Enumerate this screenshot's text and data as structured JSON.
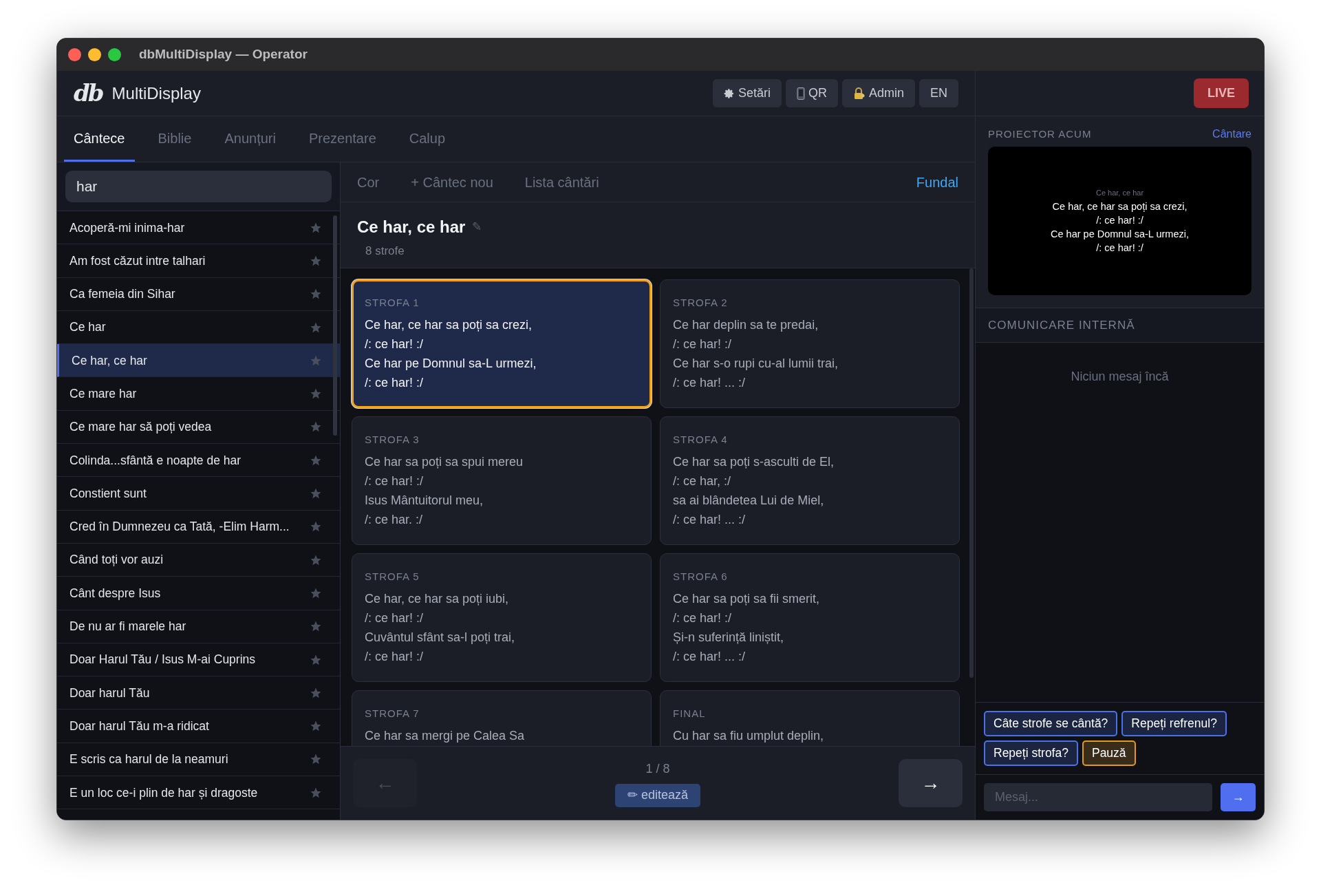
{
  "window": {
    "title": "dbMultiDisplay — Operator"
  },
  "header": {
    "logo": "db",
    "app_name": "MultiDisplay",
    "buttons": [
      {
        "label": "Setări",
        "kind": "gear"
      },
      {
        "label": "QR",
        "kind": "phone"
      },
      {
        "label": "Admin",
        "kind": "lock"
      },
      {
        "label": "EN",
        "kind": "plain"
      }
    ]
  },
  "live_button": {
    "label": "LIVE"
  },
  "tabs": [
    {
      "label": "Cântece",
      "selected": true
    },
    {
      "label": "Biblie",
      "selected": false
    },
    {
      "label": "Anunțuri",
      "selected": false
    },
    {
      "label": "Prezentare",
      "selected": false
    },
    {
      "label": "Calup",
      "selected": false
    }
  ],
  "search": {
    "value": "har"
  },
  "songs": [
    {
      "title": "Acoperă-mi inima-har",
      "selected": false
    },
    {
      "title": "Am fost căzut intre talhari",
      "selected": false
    },
    {
      "title": "Ca femeia din Sihar",
      "selected": false
    },
    {
      "title": "Ce har",
      "selected": false
    },
    {
      "title": "Ce har, ce har",
      "selected": true
    },
    {
      "title": "Ce mare har",
      "selected": false
    },
    {
      "title": "Ce mare har să poți vedea",
      "selected": false
    },
    {
      "title": "Colinda...sfântă e noapte de har",
      "selected": false
    },
    {
      "title": "Constient sunt",
      "selected": false
    },
    {
      "title": "Cred în Dumnezeu ca Tată, -Elim Harm...",
      "selected": false
    },
    {
      "title": "Când toți vor auzi",
      "selected": false
    },
    {
      "title": "Cânt despre Isus",
      "selected": false
    },
    {
      "title": "De nu ar fi marele har",
      "selected": false
    },
    {
      "title": "Doar Harul Tău / Isus M-ai Cuprins",
      "selected": false
    },
    {
      "title": "Doar harul Tău",
      "selected": false
    },
    {
      "title": "Doar harul Tău m-a ridicat",
      "selected": false
    },
    {
      "title": "E scris ca harul de la neamuri",
      "selected": false
    },
    {
      "title": "E un loc ce-i plin de har și dragoste",
      "selected": false
    }
  ],
  "toolbar": {
    "items": [
      "Cor",
      "+ Cântec nou",
      "Lista cântări"
    ],
    "background_link": "Fundal"
  },
  "song": {
    "title": "Ce har, ce har",
    "edit_icon": "✎",
    "count": "8 strofe"
  },
  "verses": [
    {
      "label": "STROFA 1",
      "lines": [
        "Ce har, ce har sa poți sa crezi,",
        "/: ce har! :/",
        "Ce har pe Domnul sa-L urmezi,",
        "/: ce har! :/"
      ],
      "selected": true
    },
    {
      "label": "STROFA 2",
      "lines": [
        "Ce har deplin sa te predai,",
        "/: ce har! :/",
        "Ce har s-o rupi cu-al lumii trai,",
        "/: ce har! ... :/"
      ],
      "selected": false
    },
    {
      "label": "STROFA 3",
      "lines": [
        "Ce har sa poți sa spui mereu",
        "/: ce har! :/",
        "Isus Mântuitorul meu,",
        "/: ce har. :/"
      ],
      "selected": false
    },
    {
      "label": "STROFA 4",
      "lines": [
        "Ce har sa poți s-asculti de El,",
        "/: ce har, :/",
        "sa ai blândetea Lui de Miel,",
        "/: ce har! ... :/"
      ],
      "selected": false
    },
    {
      "label": "STROFA 5",
      "lines": [
        "Ce har, ce har sa poți iubi,",
        "/: ce har! :/",
        "Cuvântul sfânt sa-l poți trai,",
        "/: ce har! :/"
      ],
      "selected": false
    },
    {
      "label": "STROFA 6",
      "lines": [
        "Ce har sa poți sa fii smerit,",
        "/: ce har! :/",
        "Și-n suferință liniștit,",
        "/: ce har! ... :/"
      ],
      "selected": false
    },
    {
      "label": "STROFA 7",
      "lines": [
        "Ce har sa mergi pe Calea Sa"
      ],
      "selected": false
    },
    {
      "label": "FINAL",
      "lines": [
        "Cu har sa fiu umplut deplin,"
      ],
      "selected": false
    }
  ],
  "navigation": {
    "prev": {
      "icon": "←",
      "disabled": true
    },
    "position": "1 / 8",
    "edit_button": "✏ editează",
    "next": {
      "icon": "→",
      "disabled": false
    }
  },
  "projector": {
    "heading": "PROIECTOR ACUM",
    "mode": "Cântare",
    "title": "Ce har, ce har",
    "lines": [
      "Ce har, ce har sa poți sa crezi,",
      "/: ce har! :/",
      "Ce har pe Domnul sa-L urmezi,",
      "/: ce har! :/"
    ]
  },
  "communication": {
    "heading": "COMUNICARE INTERNĂ",
    "empty": "Niciun mesaj încă",
    "quick_messages": [
      {
        "label": "Câte strofe se cântă?",
        "color": "#4a72e8"
      },
      {
        "label": "Repeți refrenul?",
        "color": "#4a72e8"
      },
      {
        "label": "Repeți strofa?",
        "color": "#4a72e8"
      },
      {
        "label": "Pauză",
        "color": "#e09a1c"
      }
    ],
    "input": {
      "placeholder": "Mesaj..."
    },
    "send_icon": "→"
  }
}
